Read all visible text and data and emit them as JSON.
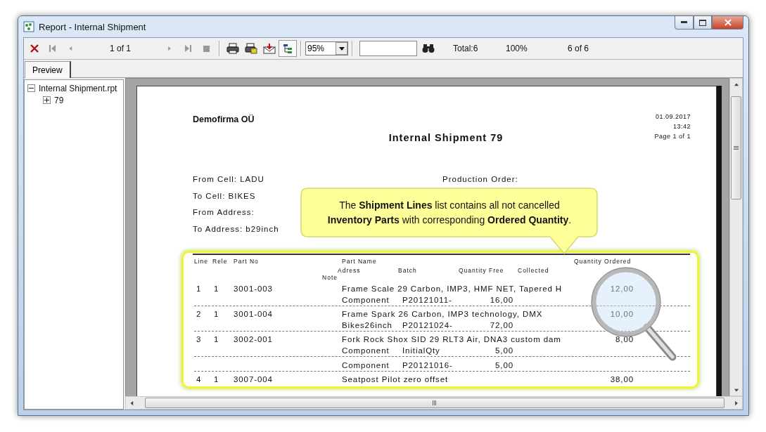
{
  "window": {
    "title": "Report - Internal Shipment"
  },
  "toolbar": {
    "page_indicator": "1 of 1",
    "zoom": "95%",
    "tree_toggle": {
      "pressed": true
    },
    "total": "Total:6",
    "percent": "100%",
    "record_count": "6 of 6"
  },
  "tabs": [
    {
      "label": "Preview",
      "selected": true
    }
  ],
  "tree": [
    {
      "label": "Internal Shipment.rpt",
      "expanded": true,
      "children": [
        {
          "label": "79",
          "expanded": false
        }
      ]
    }
  ],
  "report": {
    "company": "Demofirma OÜ",
    "title": "Internal Shipment 79",
    "date": "01.09.2017",
    "time": "13:42",
    "page": "Page 1 of 1",
    "fields_left": [
      "From Cell: LADU",
      "To Cell: BIKES",
      "From Address:",
      "To Address: b29inch"
    ],
    "fields_right": [
      "Production Order:"
    ],
    "header_main": [
      "Line",
      "Rele",
      "Part No",
      "Part Name",
      "Quantity Ordered"
    ],
    "header_sub": [
      "Adress",
      "Batch",
      "Quantity Free",
      "Collected",
      "Note"
    ],
    "rows": [
      {
        "line": "1",
        "release": "1",
        "part_no": "3001-003",
        "part_name": "Frame Scale 29 Carbon, IMP3, HMF NET, Tapered H",
        "ordered": "12,00",
        "locations": [
          {
            "address": "Component",
            "batch": "P20121011-",
            "free": "16,00"
          }
        ]
      },
      {
        "line": "2",
        "release": "1",
        "part_no": "3001-004",
        "part_name": "Frame Spark 26 Carbon, IMP3 technology, DMX",
        "ordered": "10,00",
        "locations": [
          {
            "address": "Bikes26inch",
            "batch": "P20121024-",
            "free": "72,00"
          }
        ]
      },
      {
        "line": "3",
        "release": "1",
        "part_no": "3002-001",
        "part_name": "Fork Rock Shox SID 29 RLT3 Air, DNA3 custom dam",
        "ordered": "8,00",
        "locations": [
          {
            "address": "Component",
            "batch": "InitialQty",
            "free": "5,00"
          },
          {
            "address": "Component",
            "batch": "P20121016-",
            "free": "5,00"
          }
        ]
      },
      {
        "line": "4",
        "release": "1",
        "part_no": "3007-004",
        "part_name": "Seatpost Pilot zero offset",
        "ordered": "38,00"
      }
    ]
  },
  "callout": {
    "lines": [
      "The **Shipment Lines** list contains all not cancelled",
      "**Inventory Parts** with corresponding **Ordered Quantity**."
    ]
  }
}
